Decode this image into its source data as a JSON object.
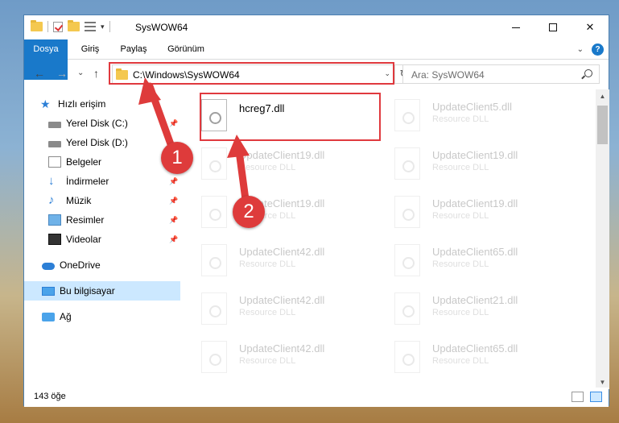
{
  "window": {
    "title": "SysWOW64",
    "controls": {
      "minimize": "—",
      "maximize": "☐",
      "close": "✕"
    }
  },
  "ribbon": {
    "tabs": [
      "Dosya",
      "Giriş",
      "Paylaş",
      "Görünüm"
    ],
    "expand_chevron": "⌄",
    "help_label": "?"
  },
  "navigation": {
    "back": "←",
    "forward": "→",
    "recent": "⌄",
    "up": "↑",
    "address": "C:\\Windows\\SysWOW64",
    "address_dropdown": "⌄",
    "refresh": "↻",
    "search_placeholder": "Ara: SysWOW64"
  },
  "sidebar": {
    "items": [
      {
        "label": "Hızlı erişim",
        "icon": "star-icon"
      },
      {
        "label": "Yerel Disk (C:)",
        "icon": "drive-icon",
        "pinned": true
      },
      {
        "label": "Yerel Disk (D:)",
        "icon": "drive-icon"
      },
      {
        "label": "Belgeler",
        "icon": "documents-icon",
        "pinned": true
      },
      {
        "label": "İndirmeler",
        "icon": "downloads-icon",
        "pinned": true
      },
      {
        "label": "Müzik",
        "icon": "music-icon",
        "pinned": true
      },
      {
        "label": "Resimler",
        "icon": "pictures-icon",
        "pinned": true
      },
      {
        "label": "Videolar",
        "icon": "videos-icon",
        "pinned": true
      },
      {
        "label": "OneDrive",
        "icon": "cloud-icon"
      },
      {
        "label": "Bu bilgisayar",
        "icon": "computer-icon",
        "selected": true
      },
      {
        "label": "Ağ",
        "icon": "network-icon"
      }
    ],
    "pin_glyph": "📌"
  },
  "files": [
    {
      "name": "hcreg7.dll",
      "type": ""
    },
    {
      "name": "UpdateClient5.dll",
      "type": "Resource DLL"
    },
    {
      "name": "UpdateClient19.dll",
      "type": "Resource DLL"
    },
    {
      "name": "UpdateClient19.dll",
      "type": "Resource DLL"
    },
    {
      "name": "UpdateClient19.dll",
      "type": "Resource DLL"
    },
    {
      "name": "UpdateClient19.dll",
      "type": "Resource DLL"
    },
    {
      "name": "UpdateClient42.dll",
      "type": "Resource DLL"
    },
    {
      "name": "UpdateClient65.dll",
      "type": "Resource DLL"
    },
    {
      "name": "UpdateClient42.dll",
      "type": "Resource DLL"
    },
    {
      "name": "UpdateClient21.dll",
      "type": "Resource DLL"
    },
    {
      "name": "UpdateClient42.dll",
      "type": "Resource DLL"
    },
    {
      "name": "UpdateClient65.dll",
      "type": "Resource DLL"
    }
  ],
  "status": {
    "item_count": "143 öğe"
  },
  "annotations": {
    "step1": "1",
    "step2": "2",
    "highlight_color": "#e0393e",
    "badge_color": "#de3b3b"
  }
}
